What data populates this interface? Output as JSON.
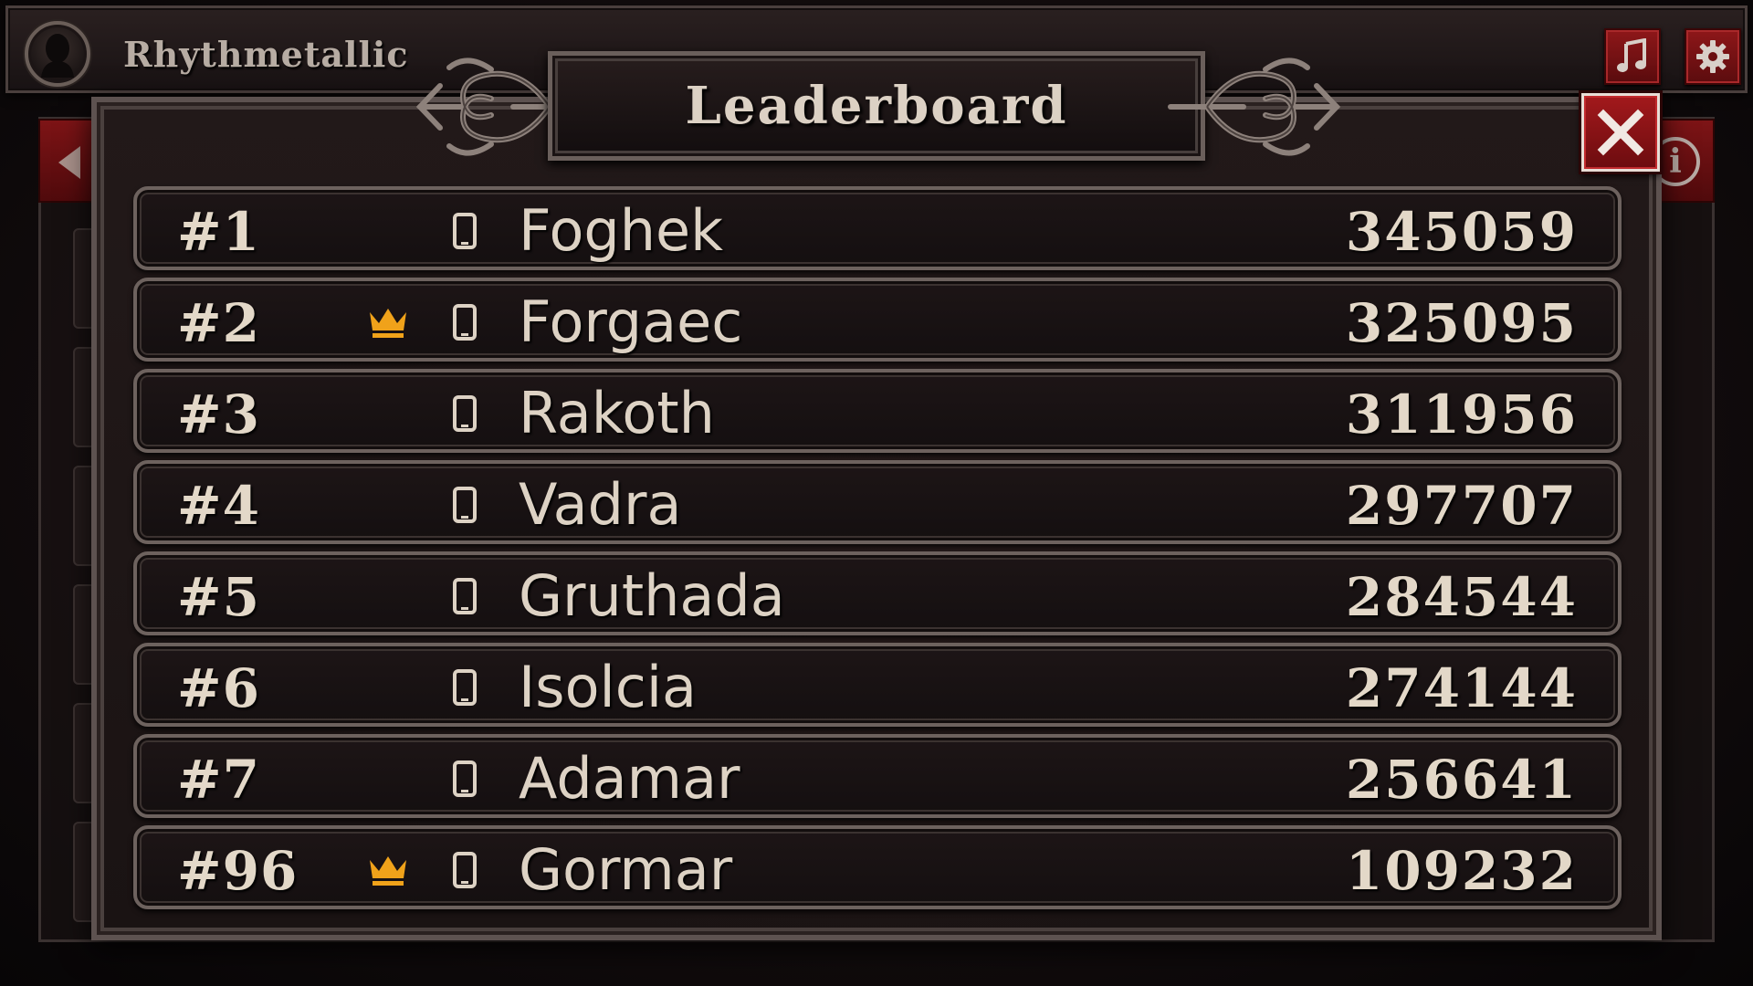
{
  "app": {
    "title": "Rhythmetallic"
  },
  "topbar": {
    "music_icon": "music-note-icon",
    "settings_icon": "gear-icon"
  },
  "modal": {
    "title": "Leaderboard",
    "close_icon": "close-x-icon"
  },
  "colors": {
    "accent_red": "#8e1719",
    "crown_gold": "#f0a21a",
    "text_light": "#e3d8c8",
    "frame_metal": "#6d625e"
  },
  "leaderboard": [
    {
      "rank": "#1",
      "crown": false,
      "platform_icon": "phone-icon",
      "name": "Foghek",
      "score": "345059"
    },
    {
      "rank": "#2",
      "crown": true,
      "platform_icon": "phone-icon",
      "name": "Forgaec",
      "score": "325095"
    },
    {
      "rank": "#3",
      "crown": false,
      "platform_icon": "phone-icon",
      "name": "Rakoth",
      "score": "311956"
    },
    {
      "rank": "#4",
      "crown": false,
      "platform_icon": "phone-icon",
      "name": "Vadra",
      "score": "297707"
    },
    {
      "rank": "#5",
      "crown": false,
      "platform_icon": "phone-icon",
      "name": "Gruthada",
      "score": "284544"
    },
    {
      "rank": "#6",
      "crown": false,
      "platform_icon": "phone-icon",
      "name": "Isolcia",
      "score": "274144"
    },
    {
      "rank": "#7",
      "crown": false,
      "platform_icon": "phone-icon",
      "name": "Adamar",
      "score": "256641"
    },
    {
      "rank": "#96",
      "crown": true,
      "platform_icon": "phone-icon",
      "name": "Gormar",
      "score": "109232"
    }
  ]
}
